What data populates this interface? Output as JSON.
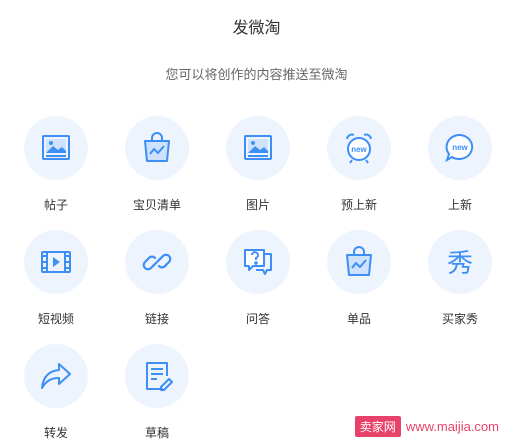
{
  "header": {
    "title": "发微淘",
    "subtitle": "您可以将创作的内容推送至微淘"
  },
  "colors": {
    "icon_stroke": "#3d8ff5",
    "circle_bg": "#edf4fe",
    "watermark": "#e9426a"
  },
  "items": [
    {
      "label": "帖子",
      "icon": "image-icon"
    },
    {
      "label": "宝贝清单",
      "icon": "shopping-bag-chart-icon"
    },
    {
      "label": "图片",
      "icon": "image-icon"
    },
    {
      "label": "预上新",
      "icon": "alarm-clock-new-icon"
    },
    {
      "label": "上新",
      "icon": "chat-bubble-new-icon"
    },
    {
      "label": "短视频",
      "icon": "film-icon"
    },
    {
      "label": "链接",
      "icon": "link-icon"
    },
    {
      "label": "问答",
      "icon": "question-bubble-icon"
    },
    {
      "label": "单品",
      "icon": "shopping-bag-chart-icon"
    },
    {
      "label": "买家秀",
      "icon": "xiu-character-icon"
    },
    {
      "label": "转发",
      "icon": "share-arrow-icon"
    },
    {
      "label": "草稿",
      "icon": "draft-edit-icon"
    }
  ],
  "icon_text": {
    "new_badge": "new",
    "xiu": "秀"
  },
  "watermark": {
    "badge": "卖家网",
    "url": "www.maijia.com"
  }
}
